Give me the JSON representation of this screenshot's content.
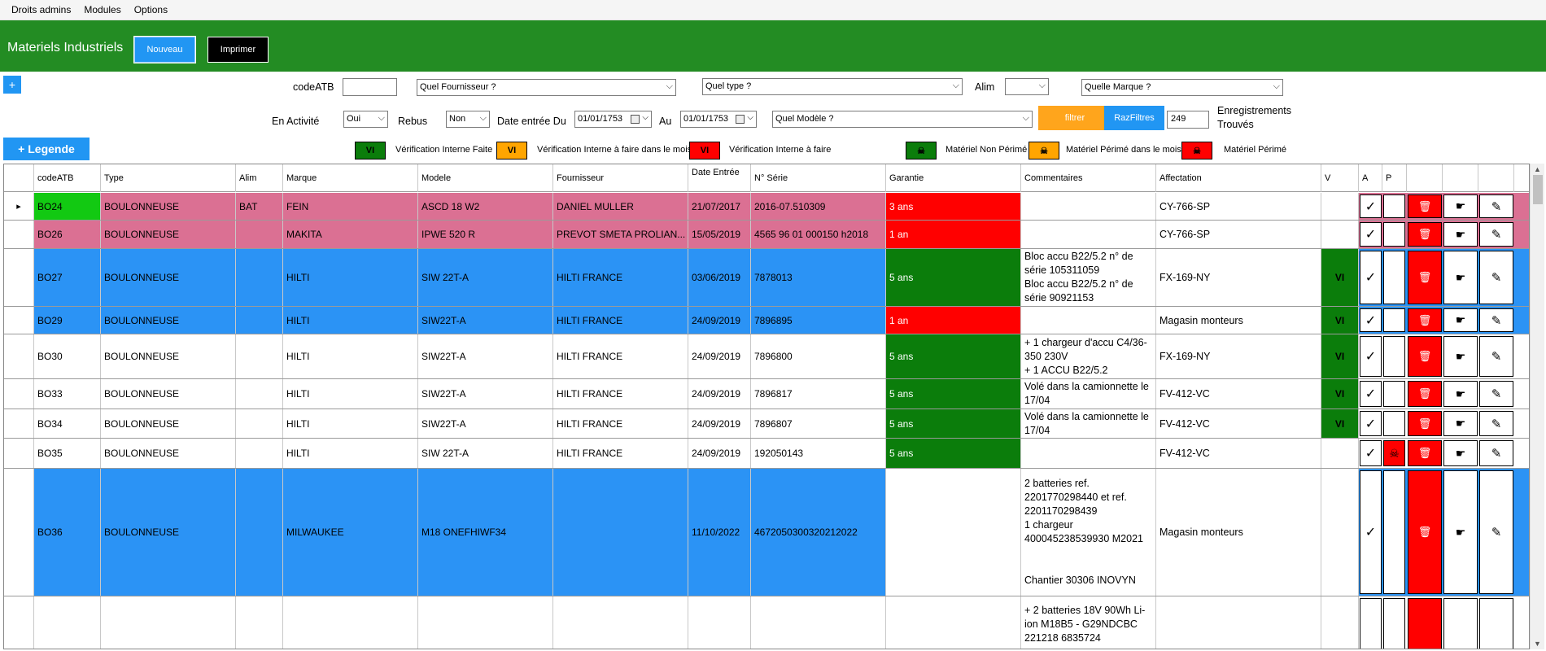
{
  "menu": [
    "Droits admins",
    "Modules",
    "Options"
  ],
  "header": {
    "title": "Materiels Industriels",
    "new_label": "Nouveau",
    "print_label": "Imprimer"
  },
  "filters": {
    "plus": "+",
    "codeatb_label": "codeATB",
    "codeatb_value": "",
    "fournisseur_placeholder": "Quel Fournisseur ?",
    "type_placeholder": "Quel type ?",
    "alim_label": "Alim",
    "alim_value": "",
    "marque_placeholder": "Quelle Marque ?",
    "activite_label": "En Activité",
    "activite_value": "Oui",
    "rebus_label": "Rebus",
    "rebus_value": "Non",
    "date_du_label": "Date entrée Du",
    "date_du_value": "01/01/1753",
    "au_label": "Au",
    "au_value": "01/01/1753",
    "modele_placeholder": "Quel Modèle ?",
    "filtrer_label": "filtrer",
    "raz_label": "RazFiltres",
    "count_value": "249",
    "count_label_1": "Enregistrements",
    "count_label_2": "Trouvés"
  },
  "legend": {
    "button": "+ Legende",
    "vi": "VI",
    "items": [
      "Vérification Interne Faite",
      "Vérification Interne à faire dans le mois",
      "Vérification Interne à faire",
      "Matériel Non Périmé",
      "Matériel Périmé dans le mois",
      "Matériel Périmé"
    ]
  },
  "icons": {
    "check": "✓",
    "skull": "☠",
    "trash": "🗑",
    "hand": "☛",
    "pen": "✎"
  },
  "columns": [
    "codeATB",
    "Type",
    "Alim",
    "Marque",
    "Modele",
    "Fournisseur",
    "Date Entrée",
    "N° Série",
    "Garantie",
    "Commentaires",
    "Affectation",
    "V",
    "A",
    "P"
  ],
  "colors": {
    "green": "#0b7d0b",
    "bright_green": "#12c912",
    "pink": "#db7093",
    "blue": "#2b93f5",
    "red": "#ff0000",
    "orange": "#ffa500"
  },
  "rows": [
    {
      "code": "BO24",
      "type": "BOULONNEUSE",
      "alim": "BAT",
      "marque": "FEIN",
      "modele": "ASCD 18 W2",
      "fournisseur": "DANIEL MULLER",
      "date": "21/07/2017",
      "serie": "2016-07.510309",
      "garantie": "3 ans",
      "commentaires": "",
      "affectation": "CY-766-SP",
      "v": "",
      "a": "✓",
      "p": ""
    },
    {
      "code": "BO26",
      "type": "BOULONNEUSE",
      "alim": "",
      "marque": "MAKITA",
      "modele": "IPWE 520 R",
      "fournisseur": "PREVOT SMETA PROLIAN...",
      "date": "15/05/2019",
      "serie": "4565 96 01 000150 h2018",
      "garantie": "1 an",
      "commentaires": "",
      "affectation": "CY-766-SP",
      "v": "",
      "a": "✓",
      "p": ""
    },
    {
      "code": "BO27",
      "type": "BOULONNEUSE",
      "alim": "",
      "marque": "HILTI",
      "modele": "SIW 22T-A",
      "fournisseur": "HILTI FRANCE",
      "date": "03/06/2019",
      "serie": "7878013",
      "garantie": "5 ans",
      "commentaires": "Bloc accu B22/5.2 n° de série 105311059\nBloc accu B22/5.2 n° de série 90921153",
      "affectation": "FX-169-NY",
      "v": "VI",
      "a": "✓",
      "p": ""
    },
    {
      "code": "BO29",
      "type": "BOULONNEUSE",
      "alim": "",
      "marque": "HILTI",
      "modele": "SIW22T-A",
      "fournisseur": "HILTI FRANCE",
      "date": "24/09/2019",
      "serie": "7896895",
      "garantie": "1 an",
      "commentaires": "",
      "affectation": "Magasin monteurs",
      "v": "VI",
      "a": "✓",
      "p": ""
    },
    {
      "code": "BO30",
      "type": "BOULONNEUSE",
      "alim": "",
      "marque": "HILTI",
      "modele": "SIW22T-A",
      "fournisseur": "HILTI FRANCE",
      "date": "24/09/2019",
      "serie": "7896800",
      "garantie": "5 ans",
      "commentaires": "+ 1 chargeur d'accu C4/36-350 230V\n+ 1 ACCU B22/5.2",
      "affectation": "FX-169-NY",
      "v": "VI",
      "a": "✓",
      "p": ""
    },
    {
      "code": "BO33",
      "type": "BOULONNEUSE",
      "alim": "",
      "marque": "HILTI",
      "modele": "SIW22T-A",
      "fournisseur": "HILTI FRANCE",
      "date": "24/09/2019",
      "serie": "7896817",
      "garantie": "5 ans",
      "commentaires": "Volé dans la camionnette le 17/04",
      "affectation": "FV-412-VC",
      "v": "VI",
      "a": "✓",
      "p": ""
    },
    {
      "code": "BO34",
      "type": "BOULONNEUSE",
      "alim": "",
      "marque": "HILTI",
      "modele": "SIW22T-A",
      "fournisseur": "HILTI FRANCE",
      "date": "24/09/2019",
      "serie": "7896807",
      "garantie": "5 ans",
      "commentaires": "Volé dans la camionnette le 17/04",
      "affectation": "FV-412-VC",
      "v": "VI",
      "a": "✓",
      "p": ""
    },
    {
      "code": "BO35",
      "type": "BOULONNEUSE",
      "alim": "",
      "marque": "HILTI",
      "modele": "SIW 22T-A",
      "fournisseur": "HILTI FRANCE",
      "date": "24/09/2019",
      "serie": "192050143",
      "garantie": "5 ans",
      "commentaires": "",
      "affectation": "FV-412-VC",
      "v": "",
      "a": "✓",
      "p": "☠"
    },
    {
      "code": "BO36",
      "type": "BOULONNEUSE",
      "alim": "",
      "marque": "MILWAUKEE",
      "modele": "M18 ONEFHIWF34",
      "fournisseur": "",
      "date": "11/10/2022",
      "serie": "4672050300320212022",
      "garantie": "",
      "commentaires": "2 batteries ref. 2201770298440 et ref. 2201170298439\n1 chargeur 400045238539930 M2021\n\n\nChantier 30306 INOVYN",
      "affectation": "Magasin monteurs",
      "v": "",
      "a": "✓",
      "p": ""
    },
    {
      "code": "",
      "type": "",
      "alim": "",
      "marque": "",
      "modele": "",
      "fournisseur": "",
      "date": "",
      "serie": "",
      "garantie": "",
      "commentaires": "+ 2 batteries 18V 90Wh Li-ion M18B5 - G29NDCBC 221218 6835724",
      "affectation": "",
      "v": "",
      "a": "",
      "p": ""
    }
  ]
}
